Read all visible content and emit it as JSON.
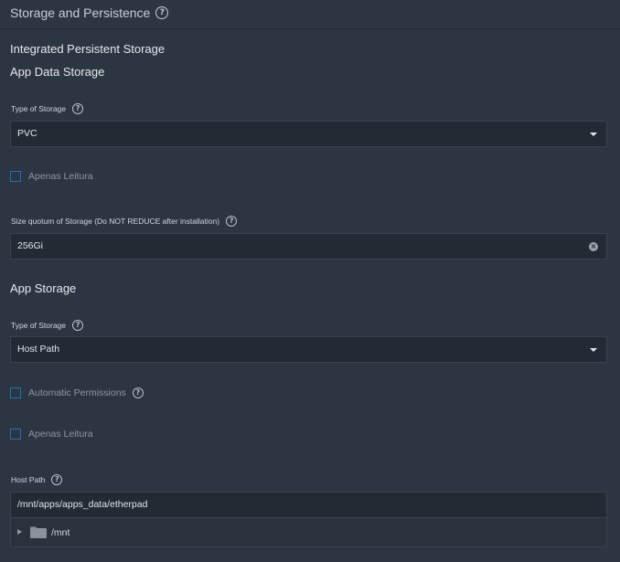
{
  "section": {
    "title": "Storage and Persistence",
    "help_icon": "help-circle-icon"
  },
  "integrated_heading": "Integrated Persistent Storage",
  "app_data_storage": {
    "heading": "App Data Storage",
    "type_label": "Type of Storage",
    "type_value": "PVC",
    "readonly_label": "Apenas Leitura",
    "readonly_checked": false,
    "size_label": "Size quotum of Storage (Do NOT REDUCE after installation)",
    "size_value": "256Gi"
  },
  "app_storage": {
    "heading": "App Storage",
    "type_label": "Type of Storage",
    "type_value": "Host Path",
    "auto_permissions_label": "Automatic Permissions",
    "auto_permissions_checked": false,
    "readonly_label": "Apenas Leitura",
    "readonly_checked": false,
    "host_path_label": "Host Path",
    "host_path_value": "/mnt/apps/apps_data/etherpad",
    "tree": {
      "folder_icon": "folder-icon",
      "label": "/mnt"
    }
  },
  "colors": {
    "background": "#2c3542",
    "input_bg": "#222a34",
    "checkbox_border": "#2e6f9e"
  }
}
